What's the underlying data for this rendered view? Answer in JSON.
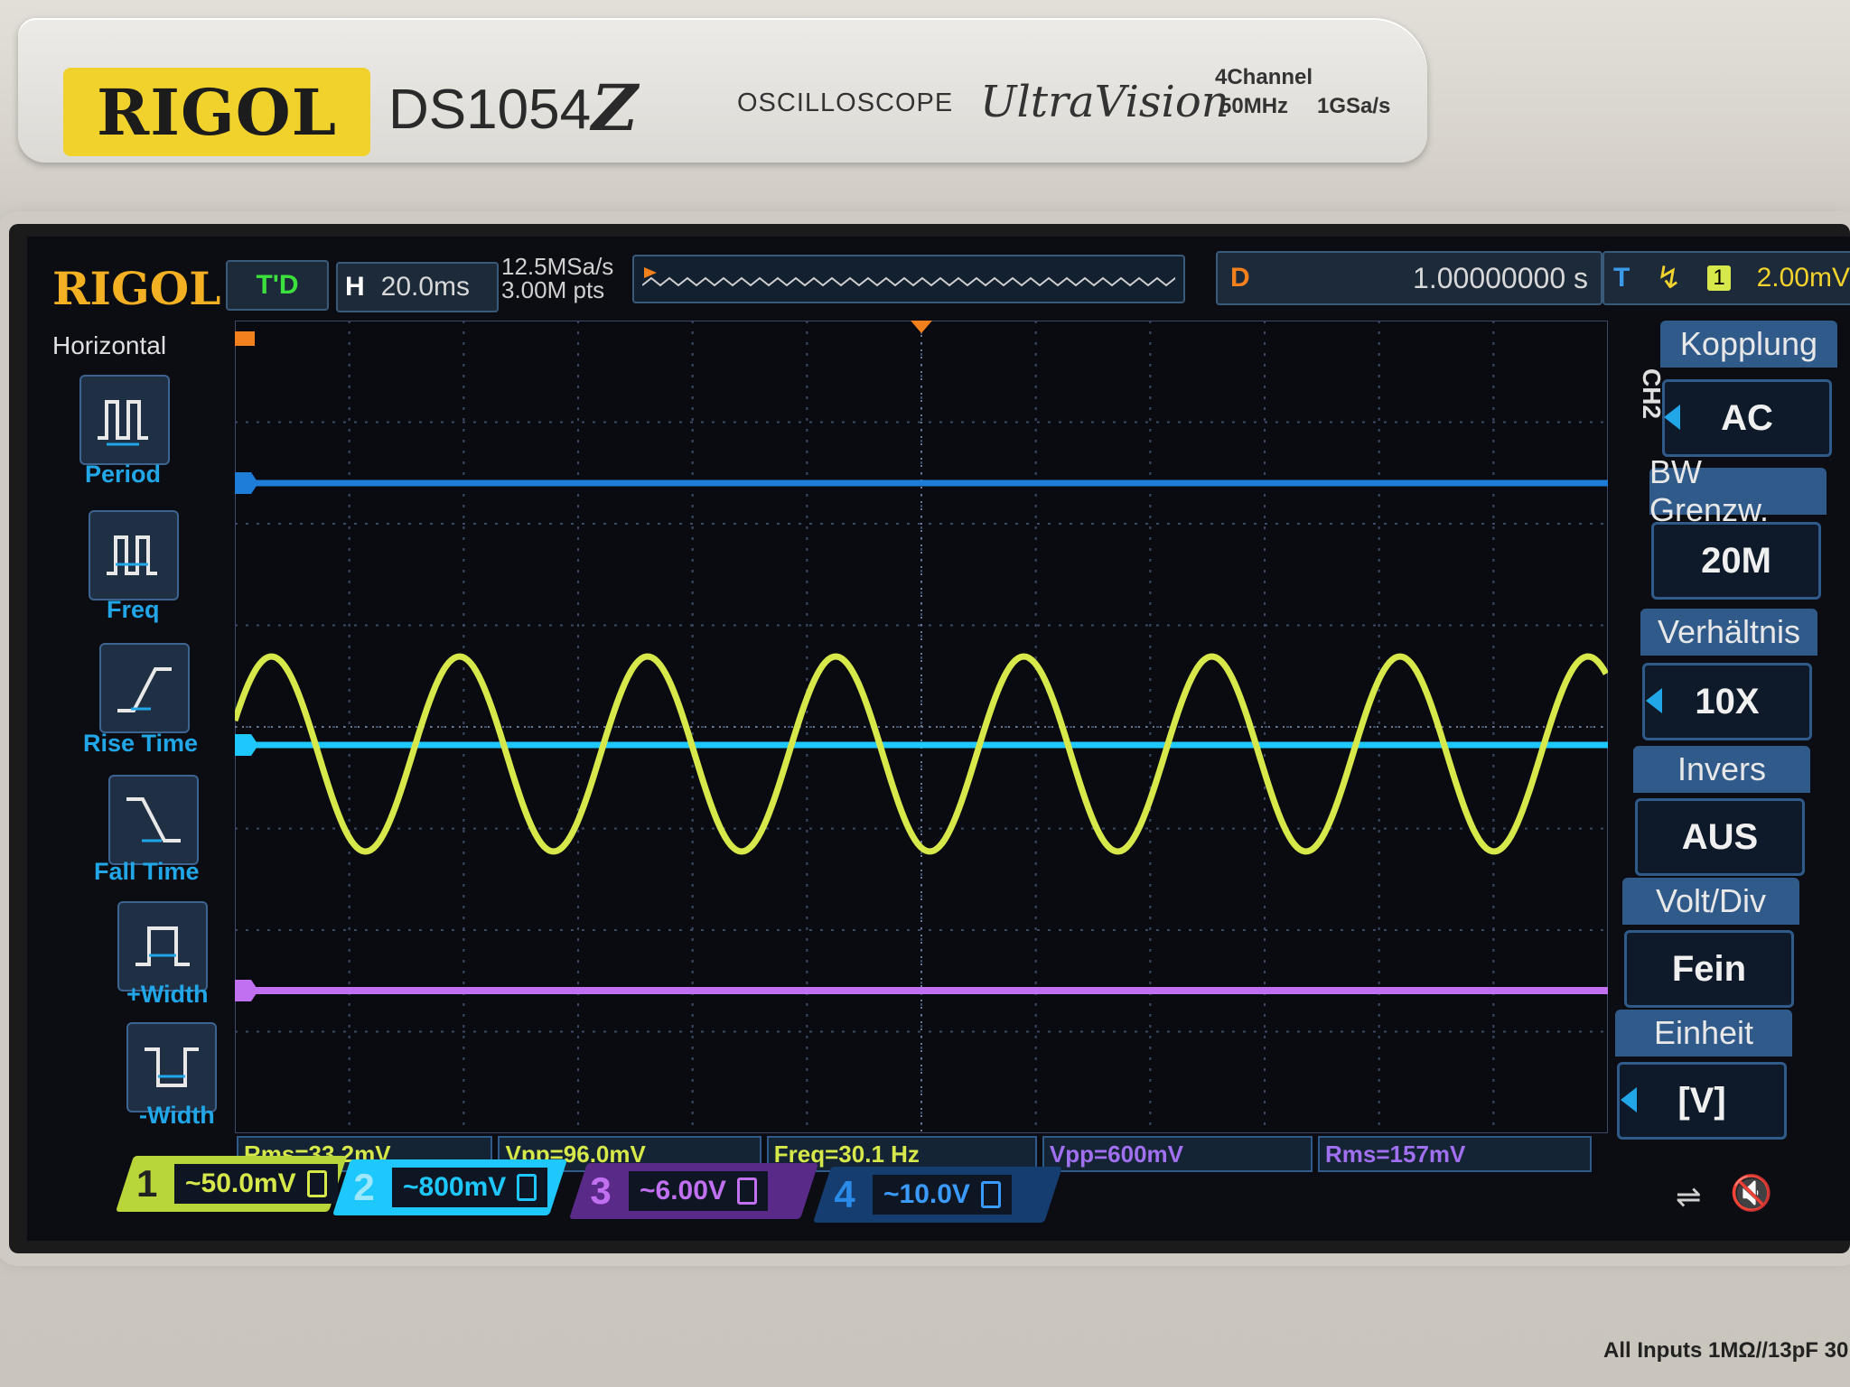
{
  "device": {
    "brand": "RIGOL",
    "model": "DS1054",
    "model_suffix": "Z",
    "type": "OSCILLOSCOPE",
    "series": "UltraVision",
    "spec_channels": "4Channel",
    "spec_bandwidth": "50MHz",
    "spec_rate": "1GSa/s",
    "footer": "All Inputs 1MΩ//13pF 30"
  },
  "status_bar": {
    "logo": "RIGOL",
    "trigger_state": "T'D",
    "horizontal_label": "H",
    "timebase": "20.0ms",
    "sample_rate": "12.5MSa/s",
    "memory_depth": "3.00M pts",
    "delay_label": "D",
    "delay_value": "1.00000000 s",
    "trigger_label": "T",
    "trigger_source": "1",
    "trigger_level": "2.00mV"
  },
  "sidebar": {
    "title": "Horizontal",
    "items": [
      {
        "label": "Period",
        "icon": "period-icon"
      },
      {
        "label": "Freq",
        "icon": "freq-icon"
      },
      {
        "label": "Rise Time",
        "icon": "rise-time-icon"
      },
      {
        "label": "Fall Time",
        "icon": "fall-time-icon"
      },
      {
        "label": "+Width",
        "icon": "positive-width-icon"
      },
      {
        "label": "-Width",
        "icon": "negative-width-icon"
      }
    ]
  },
  "menu": {
    "channel": "CH2",
    "items": [
      {
        "label": "Kopplung",
        "value": "AC"
      },
      {
        "label": "BW Grenzw.",
        "value": "20M"
      },
      {
        "label": "Verhältnis",
        "value": "10X"
      },
      {
        "label": "Invers",
        "value": "AUS"
      },
      {
        "label": "Volt/Div",
        "value": "Fein"
      },
      {
        "label": "Einheit",
        "value": "[V]"
      }
    ]
  },
  "measurements": [
    {
      "text": "Rms=33.2mV",
      "color": "#d7e84a"
    },
    {
      "text": "Vpp=96.0mV",
      "color": "#d7e84a"
    },
    {
      "text": "Freq=30.1 Hz",
      "color": "#d7e84a"
    },
    {
      "text": "Vpp=600mV",
      "color": "#a070f0"
    },
    {
      "text": "Rms=157mV",
      "color": "#a070f0"
    }
  ],
  "channels": [
    {
      "num": "1",
      "scale": "~50.0mV",
      "color": "#d7e84a"
    },
    {
      "num": "2",
      "scale": "~800mV",
      "color": "#1ec8ff"
    },
    {
      "num": "3",
      "scale": "~6.00V",
      "color": "#a070f0"
    },
    {
      "num": "4",
      "scale": "~10.0V",
      "color": "#1e7dd8"
    }
  ],
  "colors": {
    "ch1": "#d7e84a",
    "ch2": "#1ec8ff",
    "ch3": "#c070f0",
    "ch4": "#1e7dd8",
    "accent": "#f2b022"
  },
  "waveforms": {
    "ch1_cycles_visible": 7.3,
    "ch1_frequency": "30.1 Hz"
  }
}
